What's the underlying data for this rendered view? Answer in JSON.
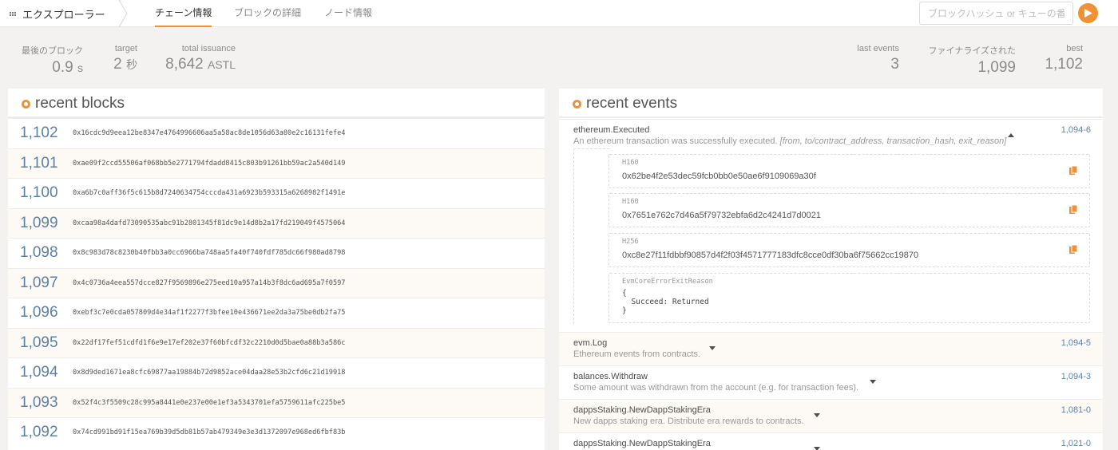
{
  "nav": {
    "app_label": "エクスプローラー",
    "tabs": [
      {
        "label": "チェーン情報",
        "active": true
      },
      {
        "label": "ブロックの詳細",
        "active": false
      },
      {
        "label": "ノード情報",
        "active": false
      }
    ],
    "search_placeholder": "ブロックハッシュ or キューの番号",
    "accent_color": "#f19135",
    "link_color": "#5c81a6"
  },
  "summary": {
    "last_block": {
      "label": "最後のブロック",
      "value": "0.9",
      "unit": "s"
    },
    "target": {
      "label": "target",
      "value": "2",
      "unit": "秒"
    },
    "total_issuance": {
      "label": "total issuance",
      "value": "8,642",
      "unit": "ASTL"
    },
    "last_events": {
      "label": "last events",
      "value": "3"
    },
    "finalized": {
      "label": "ファイナライズされた",
      "value": "1,099"
    },
    "best": {
      "label": "best",
      "value": "1,102"
    }
  },
  "recent_blocks": {
    "title": "recent blocks",
    "rows": [
      {
        "number": "1,102",
        "hash": "0x16cdc9d9eea12be8347e4764996606aa5a58ac8de1056d63a80e2c16131fefe4"
      },
      {
        "number": "1,101",
        "hash": "0xae09f2ccd55506af068bb5e2771794fdadd8415c803b91261bb59ac2a540d149"
      },
      {
        "number": "1,100",
        "hash": "0xa6b7c0aff36f5c615b8d7240634754cccda431a6923b593315a6268982f1491e"
      },
      {
        "number": "1,099",
        "hash": "0xcaa98a4dafd73090535abc91b2801345f81dc9e14d8b2a17fd219049f4575064"
      },
      {
        "number": "1,098",
        "hash": "0x8c983d78c8230b40fbb3a0cc6966ba748aa5fa40f740fdf785dc66f980ad8798"
      },
      {
        "number": "1,097",
        "hash": "0x4c0736a4eea557dcce827f9569896e275eed10a957a14b3f8dc6ad695a7f0597"
      },
      {
        "number": "1,096",
        "hash": "0xebf3c7e0cda057809d4e34af1f2277f3bfee10e436671ee2da3a75be0db2fa75"
      },
      {
        "number": "1,095",
        "hash": "0x22df17fef51cdfd1f6e9e17ef202e37f60bfcdf32c2210d0d5bae0a88b3a586c"
      },
      {
        "number": "1,094",
        "hash": "0x8d9ded1671ea8cfc69877aa19884b72d9852ace04daa28e53b2cfd6c21d19918"
      },
      {
        "number": "1,093",
        "hash": "0x52f4c3f5509c28c995a8441e0e237e00e1ef3a5343701efa5759611afc225be5"
      },
      {
        "number": "1,092",
        "hash": "0x74cd991bd91f15ea769b39d5db81b57ab479349e3e3d1372097e968ed6fbf83b"
      }
    ]
  },
  "recent_events": {
    "title": "recent events",
    "events": [
      {
        "name": "ethereum.Executed",
        "desc": "An ethereum transaction was successfully executed.",
        "desc_args": "[from, to/contract_address, transaction_hash, exit_reason]",
        "id": "1,094-6",
        "expanded": true
      },
      {
        "name": "evm.Log",
        "desc": "Ethereum events from contracts.",
        "id": "1,094-5"
      },
      {
        "name": "balances.Withdraw",
        "desc": "Some amount was withdrawn from the account (e.g. for transaction fees).",
        "id": "1,094-3"
      },
      {
        "name": "dappsStaking.NewDappStakingEra",
        "desc": "New dapps staking era. Distribute era rewards to contracts.",
        "id": "1,081-0"
      },
      {
        "name": "dappsStaking.NewDappStakingEra",
        "desc": "",
        "id": "1,021-0"
      }
    ],
    "params": [
      {
        "type": "H160",
        "value": "0x62be4f2e53dec59fcb0bb0e50ae6f9109069a30f"
      },
      {
        "type": "H160",
        "value": "0x7651e762c7d46a5f79732ebfa6d2c4241d7d0021"
      },
      {
        "type": "H256",
        "value": "0xc8e27f11fdbbf90857d4f2f03f4571777183dfc8cce0df30ba6f75662cc19870"
      },
      {
        "type": "EvmCoreErrorExitReason",
        "value": "{\n  Succeed: Returned\n}"
      }
    ]
  }
}
